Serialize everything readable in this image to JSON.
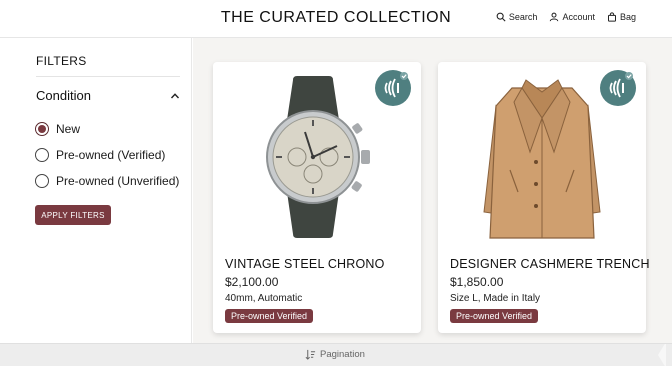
{
  "header": {
    "brand": "THE CURATED COLLECTION",
    "nav": [
      {
        "label": "Search",
        "icon": "search-icon"
      },
      {
        "label": "Account",
        "icon": "account-icon"
      },
      {
        "label": "Bag",
        "icon": "bag-icon"
      }
    ]
  },
  "sidebar": {
    "title": "FILTERS",
    "condition": {
      "label": "Condition",
      "expanded": true,
      "options": [
        {
          "label": "New",
          "checked": true
        },
        {
          "label": "Pre-owned (Verified)",
          "checked": false
        },
        {
          "label": "Pre-owned (Unverified)",
          "checked": false
        }
      ]
    },
    "apply_label": "APPLY FILTERS"
  },
  "products": [
    {
      "title": "VINTAGE STEEL CHRONO",
      "price": "$2,100.00",
      "description": "40mm, Automatic",
      "badge": "Pre-owned Verified",
      "image": "chronograph-watch",
      "nfc_icon": "nfc-verified-icon"
    },
    {
      "title": "DESIGNER CASHMERE TRENCH",
      "price": "$1,850.00",
      "description": "Size L, Made in Italy",
      "badge": "Pre-owned Verified",
      "image": "trench-coat",
      "nfc_icon": "nfc-verified-icon"
    }
  ],
  "footer": {
    "pagination_label": "Pagination",
    "pagination_icon": "sort-icon"
  },
  "colors": {
    "accent": "#7a3a40",
    "nfc_badge": "#4f7f80",
    "main_bg": "#f5f4f2"
  }
}
